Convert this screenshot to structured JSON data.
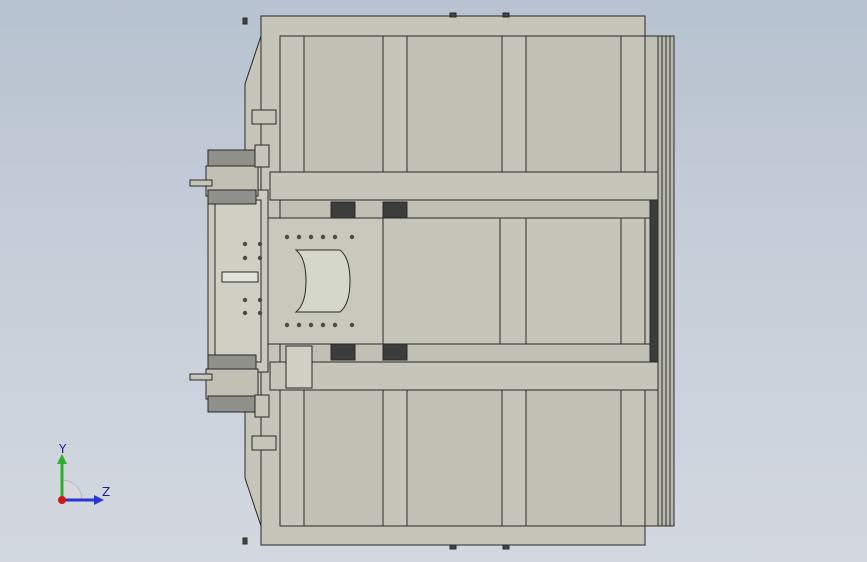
{
  "viewport": {
    "background_top": "#b7c2d0",
    "background_bottom": "#d3d8e0"
  },
  "model": {
    "body_fill": "#c5c6b9",
    "panel_fill": "#c0c1b4",
    "edge_color": "#2a2a2a",
    "dark_block_color": "#3a3d3a"
  },
  "triad": {
    "y_label": "Y",
    "z_label": "Z",
    "y_color": "#2fae2f",
    "z_color": "#2a35d8",
    "x_color": "#d01818"
  }
}
